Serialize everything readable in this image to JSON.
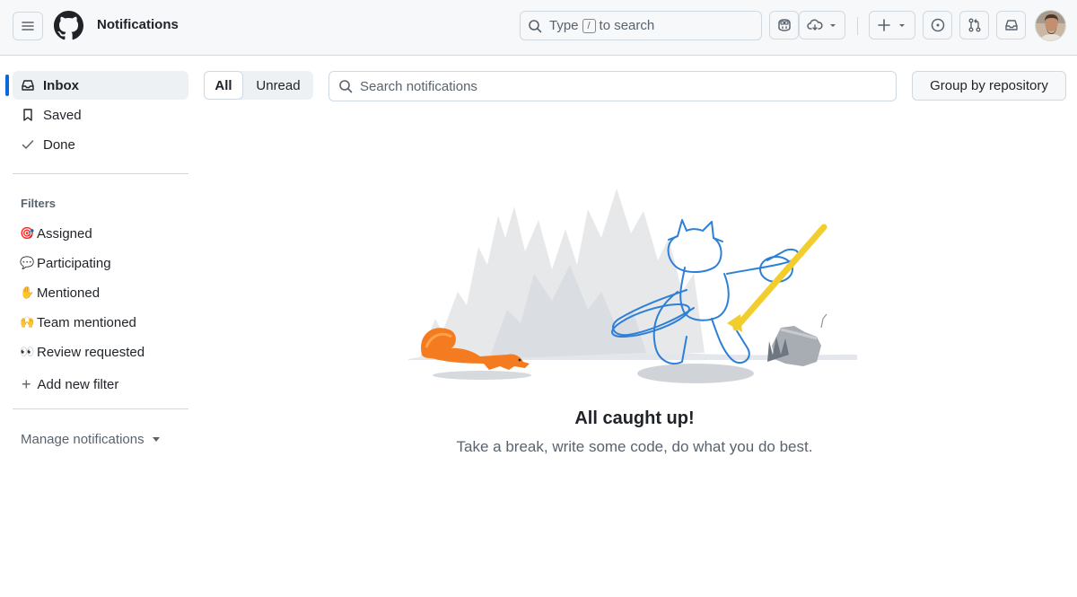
{
  "header": {
    "title": "Notifications",
    "search": {
      "before": "Type",
      "key": "/",
      "after": "to search"
    }
  },
  "sidebar": {
    "items": [
      {
        "label": "Inbox",
        "icon": "inbox-icon",
        "active": true
      },
      {
        "label": "Saved",
        "icon": "bookmark-icon"
      },
      {
        "label": "Done",
        "icon": "check-icon"
      }
    ],
    "filters_heading": "Filters",
    "filters": [
      {
        "label": "Assigned",
        "emoji": "🎯"
      },
      {
        "label": "Participating",
        "emoji": "💬"
      },
      {
        "label": "Mentioned",
        "emoji": "✋"
      },
      {
        "label": "Team mentioned",
        "emoji": "🙌"
      },
      {
        "label": "Review requested",
        "emoji": "👀"
      }
    ],
    "add_filter": "Add new filter",
    "manage": "Manage notifications"
  },
  "toolbar": {
    "tab_all": "All",
    "tab_unread": "Unread",
    "search_placeholder": "Search notifications",
    "group_button": "Group by repository"
  },
  "empty_state": {
    "title": "All caught up!",
    "subtitle": "Take a break, write some code, do what you do best."
  },
  "colors": {
    "accent": "#0969da",
    "squirrel": "#f47b20",
    "broom": "#f2cd2e",
    "octocat_stroke": "#2d7fd7"
  }
}
